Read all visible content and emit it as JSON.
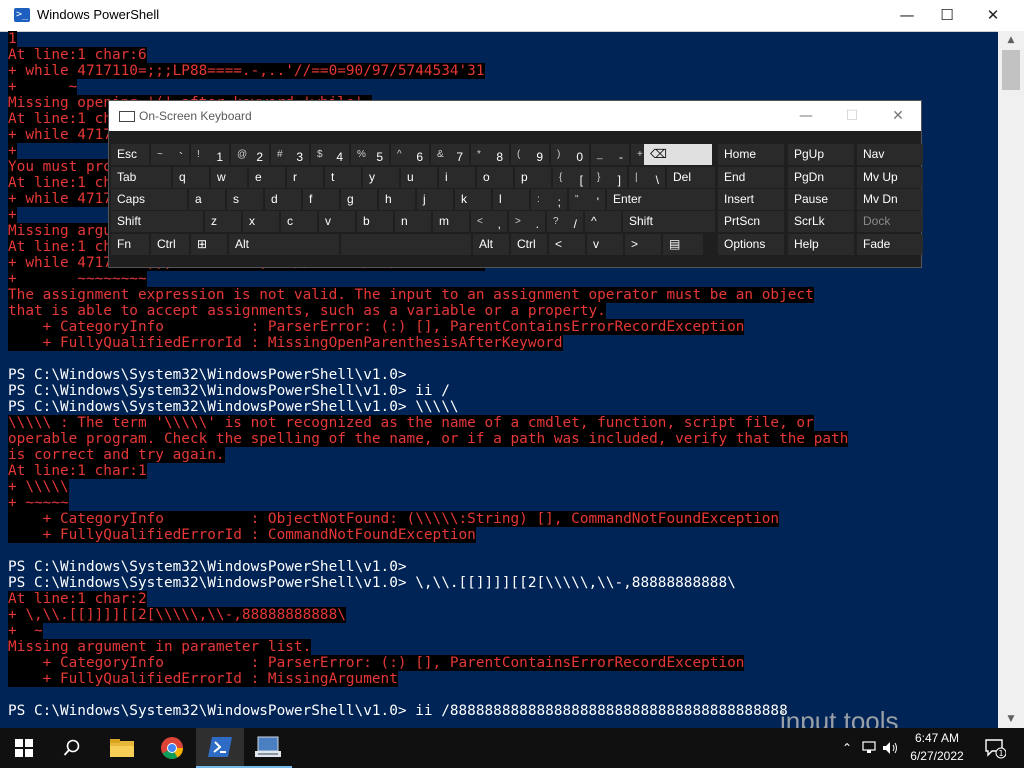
{
  "window": {
    "title": "Windows PowerShell",
    "minimize": "—",
    "maximize": "☐",
    "close": "✕"
  },
  "console": [
    {
      "t": "1",
      "c": "err"
    },
    {
      "t": "At line:1 char:6",
      "c": "err"
    },
    {
      "t": "+ while 4717110=;;;LP88====.-,..'//==0=90/97/5744534'31",
      "c": "err"
    },
    {
      "t": "+      ~",
      "c": "err"
    },
    {
      "t": "Missing opening '(' after keyword 'while'.",
      "c": "err"
    },
    {
      "t": "At line:1 char:6",
      "c": "err"
    },
    {
      "t": "+ while 4717110=;;;LP88====.-,..'//==0=90/97/5744534'31",
      "c": "err"
    },
    {
      "t": "+",
      "c": "err"
    },
    {
      "t": "You must provide a value expression following the '=' operator.",
      "c": "err"
    },
    {
      "t": "At line:1 char:6",
      "c": "err"
    },
    {
      "t": "+ while 4717110=;;;LP88====.-,..'//==0=90/97/5744534'31",
      "c": "err"
    },
    {
      "t": "+",
      "c": "err"
    },
    {
      "t": "Missing argument in parameter list.",
      "c": "err"
    },
    {
      "t": "At line:1 char:6",
      "c": "err"
    },
    {
      "t": "+ while 4717110=;;;LP88====.-,..'//==0=90/97/5744534'31",
      "c": "err"
    },
    {
      "t": "+       ~~~~~~~~",
      "c": "err"
    },
    {
      "t": "The assignment expression is not valid. The input to an assignment operator must be an object",
      "c": "err"
    },
    {
      "t": "that is able to accept assignments, such as a variable or a property.",
      "c": "err"
    },
    {
      "t": "    + CategoryInfo          : ParserError: (:) [], ParentContainsErrorRecordException",
      "c": "err"
    },
    {
      "t": "    + FullyQualifiedErrorId : MissingOpenParenthesisAfterKeyword",
      "c": "err"
    },
    {
      "t": "",
      "c": "nrm"
    },
    {
      "t": "PS C:\\Windows\\System32\\WindowsPowerShell\\v1.0>",
      "c": "nrm"
    },
    {
      "t": "PS C:\\Windows\\System32\\WindowsPowerShell\\v1.0> ii /",
      "c": "nrm"
    },
    {
      "t": "PS C:\\Windows\\System32\\WindowsPowerShell\\v1.0> \\\\\\\\\\",
      "c": "nrm"
    },
    {
      "t": "\\\\\\\\\\ : The term '\\\\\\\\\\' is not recognized as the name of a cmdlet, function, script file, or",
      "c": "err"
    },
    {
      "t": "operable program. Check the spelling of the name, or if a path was included, verify that the path",
      "c": "err"
    },
    {
      "t": "is correct and try again.",
      "c": "err"
    },
    {
      "t": "At line:1 char:1",
      "c": "err"
    },
    {
      "t": "+ \\\\\\\\\\",
      "c": "err"
    },
    {
      "t": "+ ~~~~~",
      "c": "err"
    },
    {
      "t": "    + CategoryInfo          : ObjectNotFound: (\\\\\\\\\\:String) [], CommandNotFoundException",
      "c": "err"
    },
    {
      "t": "    + FullyQualifiedErrorId : CommandNotFoundException",
      "c": "err"
    },
    {
      "t": "",
      "c": "nrm"
    },
    {
      "t": "PS C:\\Windows\\System32\\WindowsPowerShell\\v1.0>",
      "c": "nrm"
    },
    {
      "t": "PS C:\\Windows\\System32\\WindowsPowerShell\\v1.0> \\,\\\\.[[]]]][[2[\\\\\\\\\\,\\\\-,88888888888\\",
      "c": "nrm"
    },
    {
      "t": "At line:1 char:2",
      "c": "err"
    },
    {
      "t": "+ \\,\\\\.[[]]]][[2[\\\\\\\\\\,\\\\-,88888888888\\",
      "c": "err"
    },
    {
      "t": "+  ~",
      "c": "err"
    },
    {
      "t": "Missing argument in parameter list.",
      "c": "err"
    },
    {
      "t": "    + CategoryInfo          : ParserError: (:) [], ParentContainsErrorRecordException",
      "c": "err"
    },
    {
      "t": "    + FullyQualifiedErrorId : MissingArgument",
      "c": "err"
    },
    {
      "t": "",
      "c": "nrm"
    },
    {
      "t": "PS C:\\Windows\\System32\\WindowsPowerShell\\v1.0> ii /888888888888888888888888888888888888888",
      "c": "nrm"
    }
  ],
  "osk": {
    "title": "On-Screen Keyboard",
    "minimize": "—",
    "maximize": "☐",
    "close": "✕",
    "rows": [
      [
        [
          "Esc",
          ""
        ],
        [
          "~",
          "`"
        ],
        [
          "!",
          "1"
        ],
        [
          "@",
          "2"
        ],
        [
          "#",
          "3"
        ],
        [
          "$",
          "4"
        ],
        [
          "%",
          "5"
        ],
        [
          "^",
          "6"
        ],
        [
          "&",
          "7"
        ],
        [
          "*",
          "8"
        ],
        [
          "(",
          "9"
        ],
        [
          ")",
          "0"
        ],
        [
          "_",
          "-"
        ],
        [
          "+",
          "="
        ],
        [
          "⌫",
          ""
        ],
        [
          "Home",
          ""
        ],
        [
          "PgUp",
          ""
        ],
        [
          "Nav",
          ""
        ]
      ],
      [
        [
          "Tab",
          ""
        ],
        [
          "q",
          ""
        ],
        [
          "w",
          ""
        ],
        [
          "e",
          ""
        ],
        [
          "r",
          ""
        ],
        [
          "t",
          ""
        ],
        [
          "y",
          ""
        ],
        [
          "u",
          ""
        ],
        [
          "i",
          ""
        ],
        [
          "o",
          ""
        ],
        [
          "p",
          ""
        ],
        [
          "{",
          "["
        ],
        [
          "}",
          "]"
        ],
        [
          "|",
          "\\"
        ],
        [
          "Del",
          ""
        ],
        [
          "End",
          ""
        ],
        [
          "PgDn",
          ""
        ],
        [
          "Mv Up",
          ""
        ]
      ],
      [
        [
          "Caps",
          ""
        ],
        [
          "a",
          ""
        ],
        [
          "s",
          ""
        ],
        [
          "d",
          ""
        ],
        [
          "f",
          ""
        ],
        [
          "g",
          ""
        ],
        [
          "h",
          ""
        ],
        [
          "j",
          ""
        ],
        [
          "k",
          ""
        ],
        [
          "l",
          ""
        ],
        [
          ":",
          ";"
        ],
        [
          "\"",
          "'"
        ],
        [
          "Enter",
          ""
        ],
        [
          "Insert",
          ""
        ],
        [
          "Pause",
          ""
        ],
        [
          "Mv Dn",
          ""
        ]
      ],
      [
        [
          "Shift",
          ""
        ],
        [
          "z",
          ""
        ],
        [
          "x",
          ""
        ],
        [
          "c",
          ""
        ],
        [
          "v",
          ""
        ],
        [
          "b",
          ""
        ],
        [
          "n",
          ""
        ],
        [
          "m",
          ""
        ],
        [
          "<",
          ","
        ],
        [
          ">",
          "."
        ],
        [
          "?",
          "/"
        ],
        [
          "^",
          ""
        ],
        [
          "Shift",
          ""
        ],
        [
          "PrtScn",
          ""
        ],
        [
          "ScrLk",
          ""
        ],
        [
          "Dock",
          ""
        ]
      ],
      [
        [
          "Fn",
          ""
        ],
        [
          "Ctrl",
          ""
        ],
        [
          "⊞",
          ""
        ],
        [
          "Alt",
          ""
        ],
        [
          "",
          ""
        ],
        [
          "Alt",
          ""
        ],
        [
          "Ctrl",
          ""
        ],
        [
          "<",
          ""
        ],
        [
          "v",
          ""
        ],
        [
          ">",
          ""
        ],
        [
          "▤",
          ""
        ],
        [
          "Options",
          ""
        ],
        [
          "Help",
          ""
        ],
        [
          "Fade",
          ""
        ]
      ]
    ]
  },
  "taskbar": {
    "time": "6:47 AM",
    "date": "6/27/2022",
    "notification_count": "1",
    "bg_text": "input tools"
  }
}
